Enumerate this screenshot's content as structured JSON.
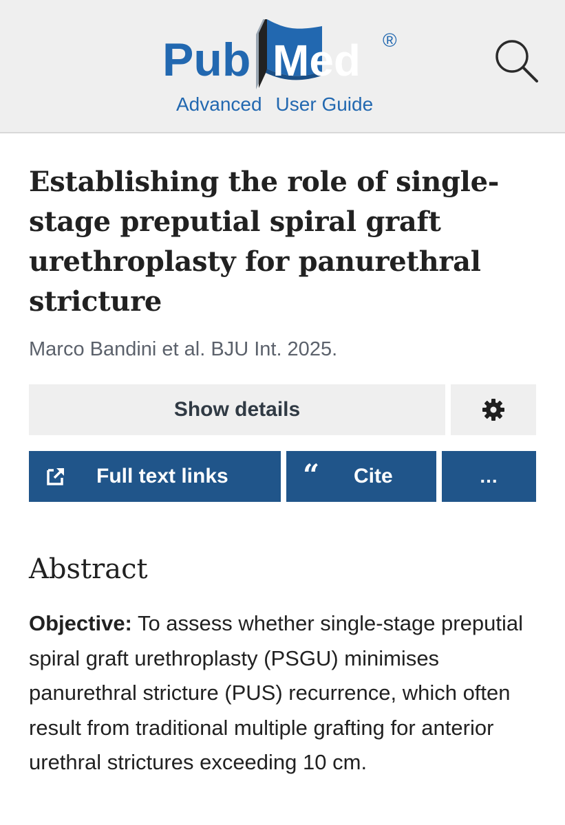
{
  "header": {
    "logo": {
      "part1": "Pub",
      "part2": "Med",
      "registered": "®",
      "colors": {
        "blue": "#2268b0",
        "book_dark": "#222222",
        "book_light": "#9aa6b2"
      }
    },
    "links": [
      "Advanced",
      "User Guide"
    ],
    "search_icon": "search-icon"
  },
  "article": {
    "title": "Establishing the role of single-stage preputial spiral graft urethroplasty for panurethral stricture",
    "byline": "Marco Bandini et al. BJU Int. 2025."
  },
  "actions": {
    "show_details": "Show details",
    "settings_icon": "gear-icon",
    "full_text_links": "Full text links",
    "full_text_icon": "external-link-icon",
    "cite_quote": "“",
    "cite": "Cite",
    "more": "..."
  },
  "abstract": {
    "heading": "Abstract",
    "objective_label": "Objective:",
    "objective_text": " To assess whether single-stage preputial spiral graft urethroplasty (PSGU) minimises panurethral stricture (PUS) recurrence, which often result from traditional multiple grafting for anterior urethral strictures exceeding 10 cm."
  },
  "colors": {
    "header_bg": "#efefef",
    "button_blue": "#20558a",
    "button_grey": "#efefef",
    "link_blue": "#2268b0",
    "byline_grey": "#5b616b",
    "text": "#212121"
  }
}
